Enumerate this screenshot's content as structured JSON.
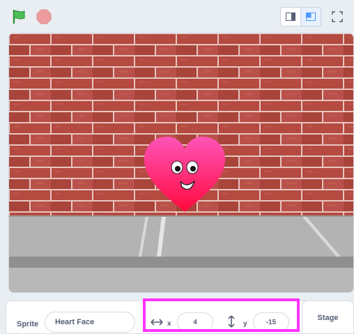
{
  "toolbar": {
    "green_flag_icon": "green-flag-icon",
    "stop_icon": "stop-icon",
    "small_stage_icon": "small-stage-icon",
    "large_stage_icon": "large-stage-icon",
    "fullscreen_icon": "fullscreen-icon",
    "flag_color": "#4cbf56",
    "stop_color": "#ec9c9c"
  },
  "stage": {
    "backdrop": "brick-wall",
    "sprite_name_on_stage": "heart-face-sprite"
  },
  "sprite_info": {
    "sprite_label": "Sprite",
    "sprite_name": "Heart Face",
    "x_label": "x",
    "x_value": "4",
    "y_label": "y",
    "y_value": "-15",
    "highlight_color": "#ff33ff"
  },
  "stage_tab": {
    "label": "Stage"
  }
}
